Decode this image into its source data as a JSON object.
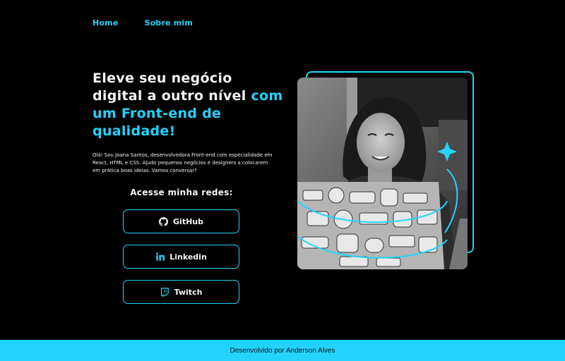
{
  "nav": {
    "home": "Home",
    "about": "Sobre mim"
  },
  "hero": {
    "headline_part1": "Eleve seu negócio digital a outro nível ",
    "headline_accent": "com um Front-end de qualidade!",
    "bio": "Olá! Sou Joana Santos, desenvolvedora Front-end com especialidade em React, HTML e CSS. Ajudo pequenos negócios e designers a colocarem em prática boas ideias. Vamos conversar?"
  },
  "social": {
    "title": "Acesse minha redes:",
    "links": [
      {
        "label": "GitHub",
        "icon": "github-icon"
      },
      {
        "label": "Linkedin",
        "icon": "linkedin-icon"
      },
      {
        "label": "Twitch",
        "icon": "twitch-icon"
      }
    ]
  },
  "footer": {
    "text": "Desenvolvido por Anderson Alves"
  },
  "colors": {
    "accent": "#22d4fd",
    "background": "#000000",
    "text": "#f5f5f5"
  }
}
